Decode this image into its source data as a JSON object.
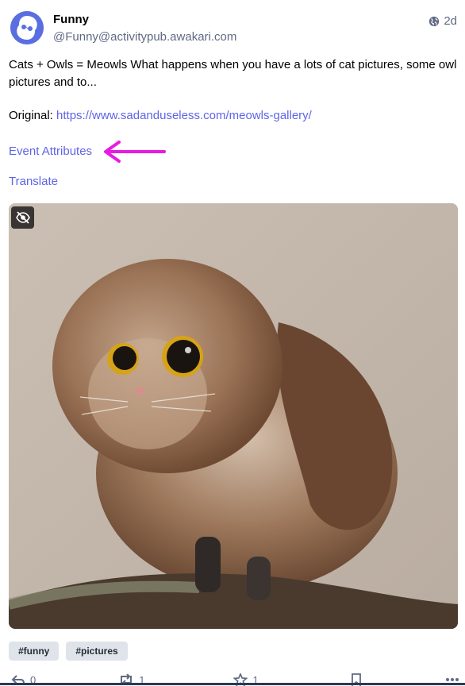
{
  "account": {
    "display_name": "Funny",
    "handle": "@Funny@activitypub.awakari.com",
    "avatar_icon": "awakari-logo-icon"
  },
  "meta": {
    "visibility_icon": "globe-icon",
    "age": "2d"
  },
  "content": {
    "summary": "Cats + Owls = Meowls What happens when you have a lots of cat pictures, some owl pictures and to...",
    "original_label": "Original:",
    "original_url": "https://www.sadanduseless.com/meowls-gallery/"
  },
  "links": {
    "event_attributes": "Event Attributes",
    "translate": "Translate"
  },
  "media": {
    "hide_icon": "eye-slash-icon",
    "description": "owl photo"
  },
  "tags": [
    "#funny",
    "#pictures"
  ],
  "actions": {
    "reply_count": "0",
    "boost_count": "1",
    "favourite_count": "1"
  },
  "colors": {
    "link": "#5e64e8",
    "annotation_arrow": "#e81be0",
    "secondary_text": "#606984"
  }
}
